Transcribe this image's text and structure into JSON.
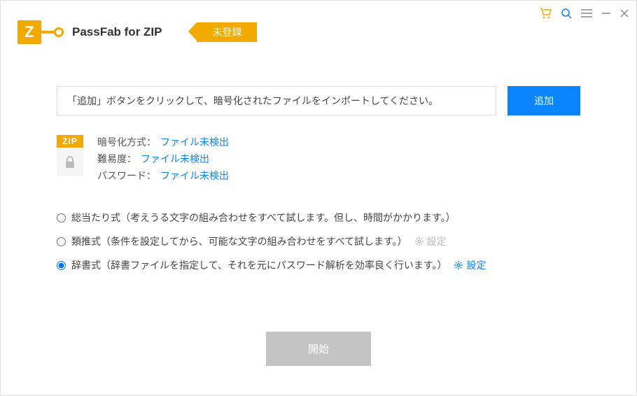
{
  "header": {
    "logo_letter": "Z",
    "product_name": "PassFab for ZIP",
    "reg_status": "未登録"
  },
  "import": {
    "placeholder_text": "「追加」ボタンをクリックして、暗号化されたファイルをインポートしてください。",
    "add_button": "追加"
  },
  "file": {
    "tag": "ZIP",
    "enc_label": "暗号化方式：",
    "enc_value": "ファイル未検出",
    "diff_label": "難易度：",
    "diff_value": "ファイル未検出",
    "pw_label": "パスワード：",
    "pw_value": "ファイル未検出"
  },
  "methods": {
    "brute": "総当たり式（考えうる文字の組み合わせをすべて試します。但し、時間がかかります。）",
    "mask": "類推式（条件を設定してから、可能な文字の組み合わせをすべて試します。）",
    "dict": "辞書式（辞書ファイルを指定して、それを元にパスワード解析を効率良く行います。）",
    "settings_label": "設定"
  },
  "start_button": "開始"
}
